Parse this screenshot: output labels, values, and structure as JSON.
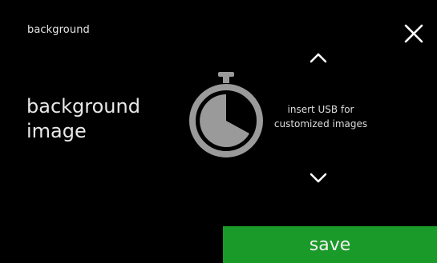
{
  "header": {
    "breadcrumb": "background",
    "close_icon": "close-icon"
  },
  "main": {
    "title_line1": "background",
    "title_line2": "image",
    "timer_icon": "stopwatch-icon",
    "message_line1": "insert USB for",
    "message_line2": "customized images",
    "up_icon": "chevron-up-icon",
    "down_icon": "chevron-down-icon"
  },
  "footer": {
    "save_label": "save"
  },
  "colors": {
    "background": "#000000",
    "accent": "#1a9a28",
    "icon_gray": "#9a9a9a"
  }
}
